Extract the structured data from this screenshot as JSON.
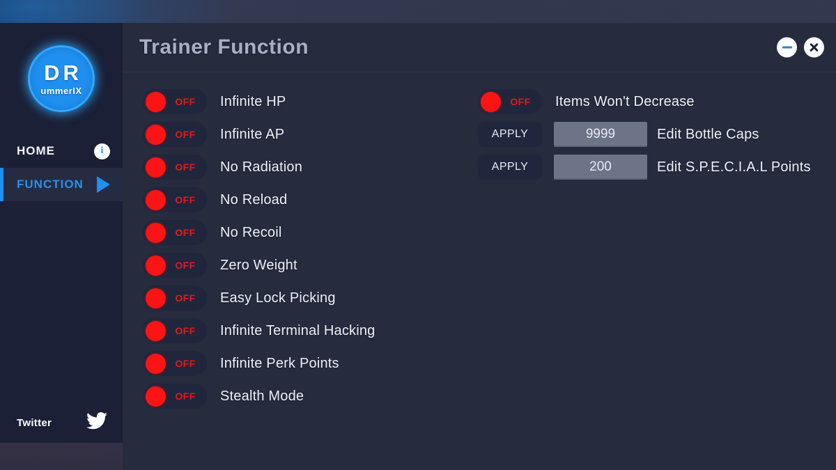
{
  "window": {
    "title": "Trainer Function",
    "controls": [
      {
        "name": "minimize",
        "icon": "minimize-icon",
        "label": "–"
      },
      {
        "name": "close",
        "icon": "close-icon",
        "label": "✕"
      }
    ]
  },
  "sidebar": {
    "logo": {
      "line1": "DR",
      "line2": "ummerIX",
      "color": "#1f8ff0"
    },
    "nav": [
      {
        "label": "HOME",
        "active": false,
        "icon": "info-icon",
        "icon_glyph": "i"
      },
      {
        "label": "FUNCTION",
        "active": true,
        "icon": "play-triangle-icon"
      }
    ],
    "social": {
      "label": "Twitter",
      "icon": "twitter-bird-icon"
    }
  },
  "colors": {
    "accent_blue": "#1f8ff0",
    "toggle_off_red": "#fa1414",
    "panel_bg": "#262b3e",
    "sidebar_bg": "#1b2036",
    "control_bg": "#20263c",
    "field_bg": "#6d7487"
  },
  "functions": {
    "left_column": [
      {
        "type": "toggle",
        "state": "OFF",
        "label": "Infinite HP"
      },
      {
        "type": "toggle",
        "state": "OFF",
        "label": "Infinite AP"
      },
      {
        "type": "toggle",
        "state": "OFF",
        "label": "No Radiation"
      },
      {
        "type": "toggle",
        "state": "OFF",
        "label": "No Reload"
      },
      {
        "type": "toggle",
        "state": "OFF",
        "label": "No Recoil"
      },
      {
        "type": "toggle",
        "state": "OFF",
        "label": "Zero Weight"
      },
      {
        "type": "toggle",
        "state": "OFF",
        "label": "Easy Lock Picking"
      },
      {
        "type": "toggle",
        "state": "OFF",
        "label": "Infinite Terminal Hacking"
      },
      {
        "type": "toggle",
        "state": "OFF",
        "label": "Infinite Perk Points"
      },
      {
        "type": "toggle",
        "state": "OFF",
        "label": "Stealth Mode"
      }
    ],
    "right_column": [
      {
        "type": "toggle",
        "state": "OFF",
        "label": "Items Won't Decrease"
      },
      {
        "type": "apply",
        "button": "APPLY",
        "value": "9999",
        "label": "Edit Bottle Caps"
      },
      {
        "type": "apply",
        "button": "APPLY",
        "value": "200",
        "label": "Edit S.P.E.C.I.A.L Points"
      }
    ]
  }
}
